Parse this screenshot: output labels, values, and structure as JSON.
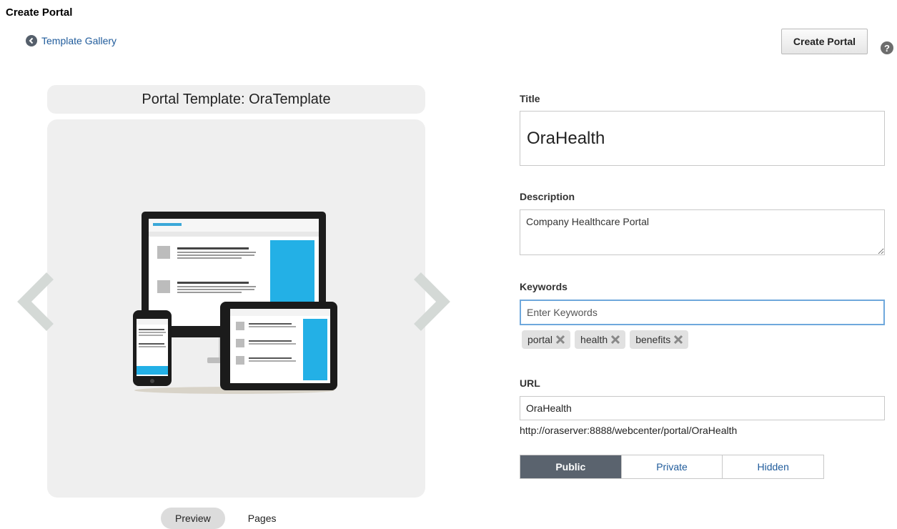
{
  "page": {
    "title": "Create Portal"
  },
  "nav": {
    "back_label": "Template Gallery"
  },
  "toolbar": {
    "create_label": "Create Portal",
    "help_glyph": "?"
  },
  "template": {
    "title": "Portal Template: OraTemplate"
  },
  "preview": {
    "tabs": [
      {
        "label": "Preview",
        "active": true
      },
      {
        "label": "Pages",
        "active": false
      }
    ]
  },
  "form": {
    "title_label": "Title",
    "title_value": "OraHealth",
    "description_label": "Description",
    "description_value": "Company Healthcare Portal",
    "keywords_label": "Keywords",
    "keywords_placeholder": "Enter Keywords",
    "keywords": [
      "portal",
      "health",
      "benefits"
    ],
    "url_label": "URL",
    "url_value": "OraHealth",
    "full_url": "http://oraserver:8888/webcenter/portal/OraHealth",
    "visibility": [
      {
        "label": "Public",
        "active": true
      },
      {
        "label": "Private",
        "active": false
      },
      {
        "label": "Hidden",
        "active": false
      }
    ]
  },
  "colors": {
    "accent": "#1f5b9b",
    "active_segment": "#5a636e",
    "panel": "#efefef",
    "focus_border": "#6fa8dc"
  }
}
